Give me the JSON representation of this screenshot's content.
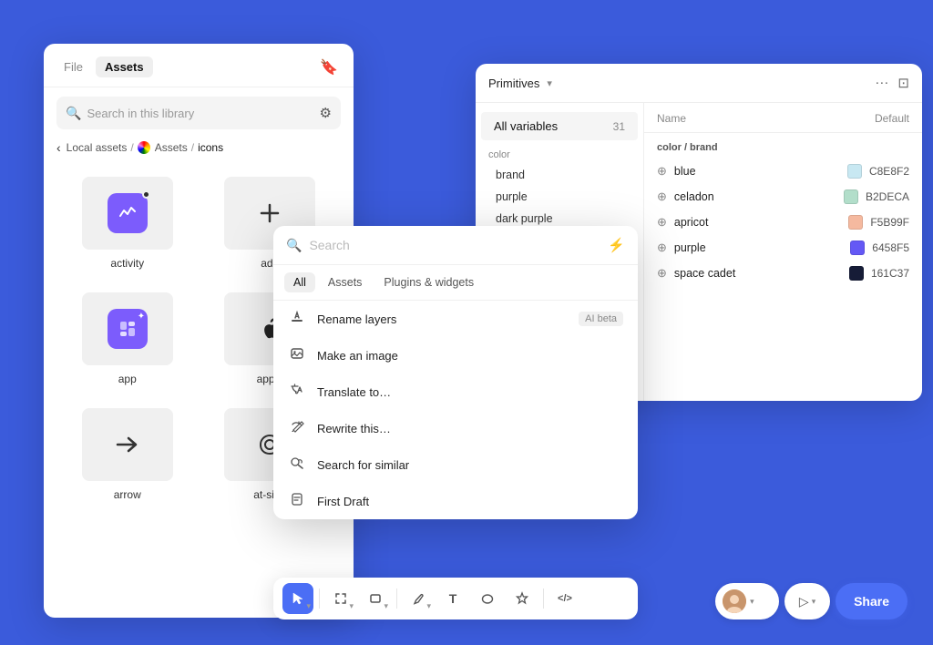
{
  "background": "#3b5bdb",
  "assetsPanel": {
    "tabs": {
      "file": "File",
      "assets": "Assets"
    },
    "search": {
      "placeholder": "Search in this library"
    },
    "breadcrumb": {
      "back": "‹",
      "localAssets": "Local assets",
      "sep1": "/",
      "assets": "Assets",
      "sep2": "/",
      "icons": "icons"
    },
    "icons": [
      {
        "name": "activity",
        "type": "activity"
      },
      {
        "name": "add",
        "type": "add"
      },
      {
        "name": "app",
        "type": "app"
      },
      {
        "name": "apple",
        "type": "apple"
      },
      {
        "name": "arrow",
        "type": "arrow"
      },
      {
        "name": "at-sign",
        "type": "at-sign"
      }
    ]
  },
  "variablesPanel": {
    "title": "Primitives",
    "allVars": "All variables",
    "count": 31,
    "groups": [
      {
        "label": "color",
        "items": [
          "brand",
          "purple",
          "dark purple"
        ]
      }
    ],
    "rightPanel": {
      "groupTitle": "color / brand",
      "columns": {
        "name": "Name",
        "default": "Default"
      },
      "rows": [
        {
          "name": "blue",
          "hex": "C8E8F2",
          "color": "#C8E8F2"
        },
        {
          "name": "celadon",
          "hex": "B2DECA",
          "color": "#B2DECA"
        },
        {
          "name": "apricot",
          "hex": "F5B99F",
          "color": "#F5B99F"
        },
        {
          "name": "purple",
          "hex": "6458F5",
          "color": "#6458F5"
        },
        {
          "name": "space cadet",
          "hex": "161C37",
          "color": "#161C37"
        }
      ]
    }
  },
  "commandPalette": {
    "searchPlaceholder": "Search",
    "tabs": [
      "All",
      "Assets",
      "Plugins & widgets"
    ],
    "activeTab": "All",
    "items": [
      {
        "icon": "✏️",
        "label": "Rename layers",
        "badge": "AI beta"
      },
      {
        "icon": "🖼️",
        "label": "Make an image",
        "badge": ""
      },
      {
        "icon": "✨",
        "label": "Translate to…",
        "badge": ""
      },
      {
        "icon": "✍️",
        "label": "Rewrite this…",
        "badge": ""
      },
      {
        "icon": "🔍",
        "label": "Search for similar",
        "badge": ""
      },
      {
        "icon": "📝",
        "label": "First Draft",
        "badge": ""
      }
    ]
  },
  "toolbar": {
    "tools": [
      {
        "icon": "↖",
        "label": "select",
        "active": true,
        "hasChevron": true
      },
      {
        "icon": "⊞",
        "label": "frame",
        "active": false,
        "hasChevron": true
      },
      {
        "icon": "▭",
        "label": "rectangle",
        "active": false,
        "hasChevron": true
      },
      {
        "icon": "✏",
        "label": "pen",
        "active": false,
        "hasChevron": true
      },
      {
        "icon": "T",
        "label": "text",
        "active": false
      },
      {
        "icon": "○",
        "label": "ellipse",
        "active": false
      },
      {
        "icon": "✦",
        "label": "ai-actions",
        "active": false
      },
      {
        "icon": "<>",
        "label": "code",
        "active": false
      }
    ]
  },
  "shareBar": {
    "playLabel": "▷",
    "shareLabel": "Share"
  }
}
